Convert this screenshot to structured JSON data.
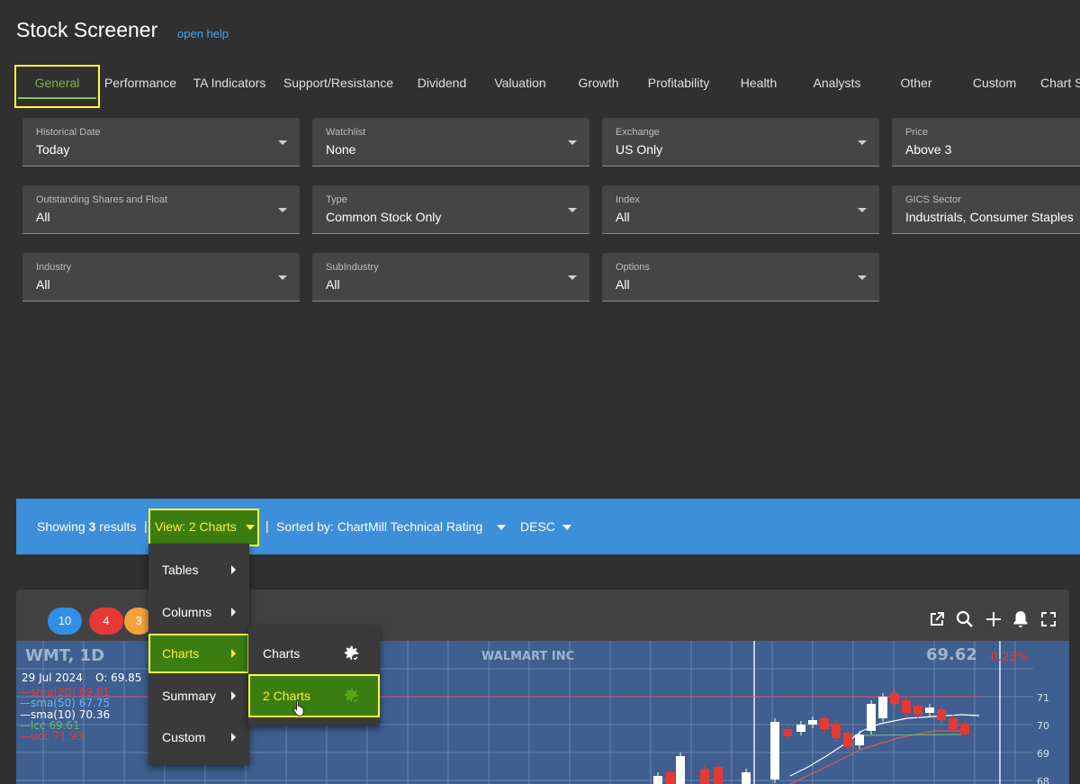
{
  "app": {
    "title": "Stock Screener",
    "help_link": "open help"
  },
  "tabs": [
    "General",
    "Performance",
    "TA Indicators",
    "Support/Resistance",
    "Dividend",
    "Valuation",
    "Growth",
    "Profitability",
    "Health",
    "Analysts",
    "Other",
    "Custom",
    "Chart S"
  ],
  "filters": [
    {
      "label": "Historical Date",
      "value": "Today"
    },
    {
      "label": "Watchlist",
      "value": "None"
    },
    {
      "label": "Exchange",
      "value": "US Only"
    },
    {
      "label": "Price",
      "value": "Above 3"
    },
    {
      "label": "Outstanding Shares and Float",
      "value": "All"
    },
    {
      "label": "Type",
      "value": "Common Stock Only"
    },
    {
      "label": "Index",
      "value": "All"
    },
    {
      "label": "GICS Sector",
      "value": "Industrials, Consumer Staples"
    },
    {
      "label": "Industry",
      "value": "All"
    },
    {
      "label": "SubIndustry",
      "value": "All"
    },
    {
      "label": "Options",
      "value": "All"
    }
  ],
  "results_bar": {
    "showing_prefix": "Showing",
    "count": "3",
    "showing_suffix": "results",
    "separator": "|",
    "view_label": "View: 2 Charts",
    "sorted_label": "Sorted by: ChartMill Technical Rating",
    "order_label": "DESC"
  },
  "view_menu": {
    "items": [
      "Tables",
      "Columns",
      "Charts",
      "Summary",
      "Custom"
    ],
    "selected": "Charts",
    "submenu": [
      "Charts",
      "2 Charts"
    ],
    "submenu_selected": "2 Charts"
  },
  "rating_badges": [
    {
      "value": "10",
      "color": "#2f8ee6"
    },
    {
      "value": "4",
      "color": "#e53935"
    },
    {
      "value": "3",
      "color": "#f5a13b"
    }
  ],
  "toolbar_icons": [
    "open-external-icon",
    "search-icon",
    "plus-icon",
    "bell-icon",
    "fullscreen-icon"
  ],
  "stock_chart": {
    "symbol": "WMT, 1D",
    "company": "WALMART INC",
    "price": "69.62",
    "change": "-0.23%",
    "date": "29 Jul 2024",
    "open": "O: 69.85",
    "indicators": [
      {
        "text": "—sma(20) 69.81",
        "color": "#e53935"
      },
      {
        "text": "—sma(50) 67.75",
        "color": "#64b5f6"
      },
      {
        "text": "—sma(10) 70.36",
        "color": "#ffffff"
      },
      {
        "text": "—lcc 69.61",
        "color": "#66bb6a"
      },
      {
        "text": "—ucc 71.93",
        "color": "#e53935"
      }
    ],
    "y_ticks": [
      "71",
      "70",
      "69",
      "68"
    ],
    "colors": {
      "up": "#ffffff",
      "down": "#e53935",
      "background": "#3e5f8f"
    }
  }
}
